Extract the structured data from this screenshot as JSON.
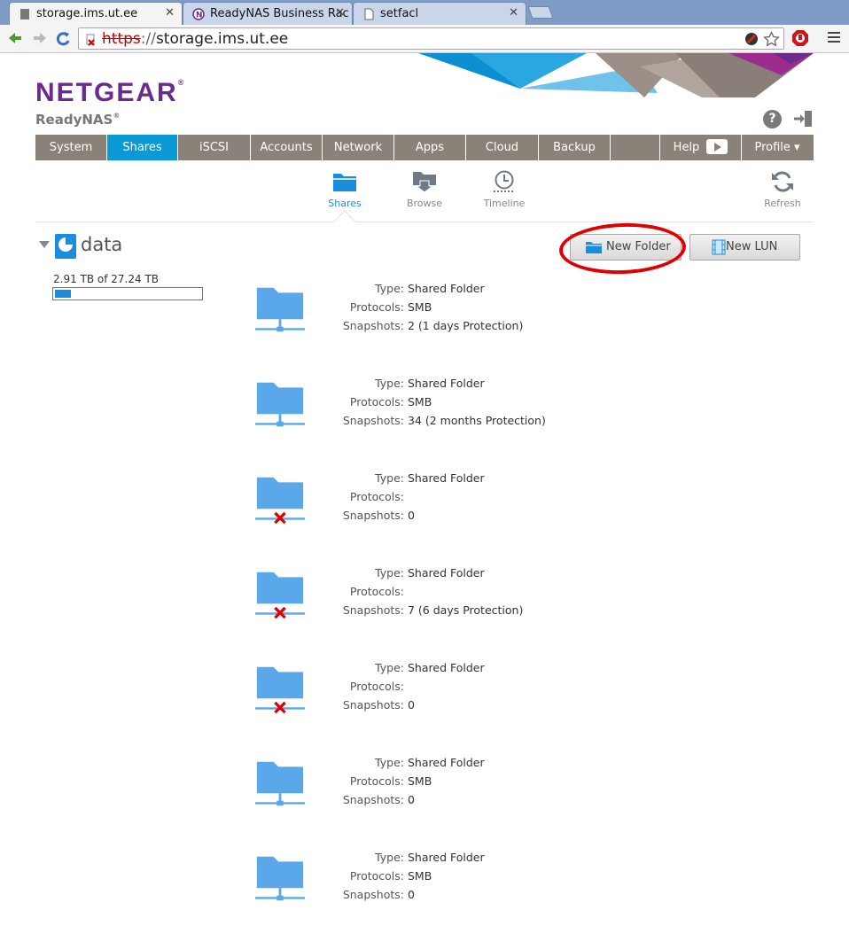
{
  "browser": {
    "tabs": [
      {
        "title": "storage.ims.ut.ee",
        "active": true
      },
      {
        "title": "ReadyNAS Business Rac",
        "active": false
      },
      {
        "title": "setfacl",
        "active": false
      }
    ],
    "address": {
      "scheme": "https",
      "sep": "://",
      "host": "storage.ims.ut.ee"
    }
  },
  "brand": {
    "logo": "NETGEAR",
    "reg": "®",
    "product": "ReadyNAS",
    "product_mark": "®",
    "accent": "#6b2b8c",
    "active_tab_color": "#0c9ad6"
  },
  "header": {
    "help_icon": "?"
  },
  "nav": {
    "items": [
      "System",
      "Shares",
      "iSCSI",
      "Accounts",
      "Network",
      "Apps",
      "Cloud",
      "Backup",
      "",
      "Help",
      "Profile ▾"
    ],
    "active": "Shares"
  },
  "subnav": {
    "shares": "Shares",
    "browse": "Browse",
    "timeline": "Timeline",
    "refresh": "Refresh"
  },
  "volume": {
    "name": "data",
    "usage": "2.91 TB of 27.24 TB",
    "used_fraction": 0.107
  },
  "actions": {
    "new_folder": "New Folder",
    "new_lun": "New LUN"
  },
  "labels": {
    "type": "Type:",
    "protocols": "Protocols:",
    "snapshots": "Snapshots:"
  },
  "shares": [
    {
      "type": "Shared Folder",
      "protocols": "SMB",
      "snapshots": "2 (1 days Protection)",
      "offline": false
    },
    {
      "type": "Shared Folder",
      "protocols": "SMB",
      "snapshots": "34 (2 months Protection)",
      "offline": false
    },
    {
      "type": "Shared Folder",
      "protocols": "",
      "snapshots": "0",
      "offline": true
    },
    {
      "type": "Shared Folder",
      "protocols": "",
      "snapshots": "7 (6 days Protection)",
      "offline": true
    },
    {
      "type": "Shared Folder",
      "protocols": "",
      "snapshots": "0",
      "offline": true
    },
    {
      "type": "Shared Folder",
      "protocols": "SMB",
      "snapshots": "0",
      "offline": false
    },
    {
      "type": "Shared Folder",
      "protocols": "SMB",
      "snapshots": "0",
      "offline": false
    }
  ]
}
